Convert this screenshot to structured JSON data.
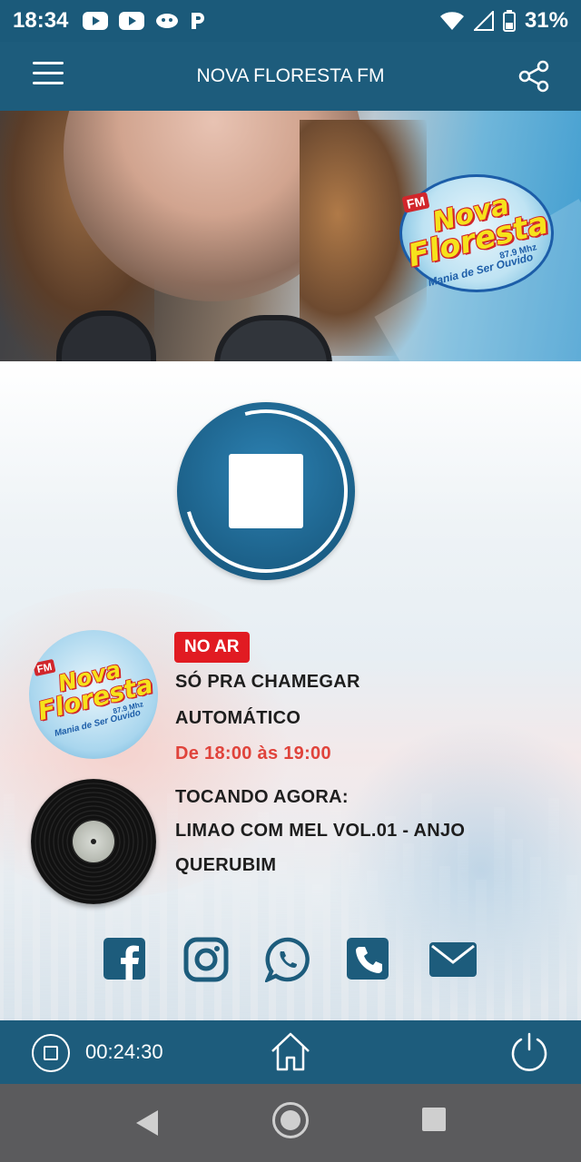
{
  "status_bar": {
    "time": "18:34",
    "battery": "31%",
    "left_icons": [
      "youtube-icon",
      "youtube-icon",
      "app-icon",
      "pandora-icon"
    ],
    "right_icons": [
      "wifi-icon",
      "signal-icon",
      "battery-icon"
    ]
  },
  "app_bar": {
    "title": "NOVA FLORESTA FM",
    "menu_icon": "menu-icon",
    "share_icon": "share-icon"
  },
  "logo": {
    "fm": "FM",
    "word1": "Nova",
    "word2": "Floresta",
    "frequency": "87.9 Mhz",
    "slogan": "Mania de Ser Ouvido"
  },
  "now_on_air": {
    "badge": "NO AR",
    "program": "SÓ PRA CHAMEGAR",
    "host": "AUTOMÁTICO",
    "schedule": "De 18:00 às 19:00"
  },
  "now_playing": {
    "label": "TOCANDO AGORA:",
    "track_line1": "LIMAO COM MEL VOL.01 - ANJO",
    "track_line2": "QUERUBIM"
  },
  "social": [
    {
      "name": "facebook-icon"
    },
    {
      "name": "instagram-icon"
    },
    {
      "name": "whatsapp-icon"
    },
    {
      "name": "phone-icon"
    },
    {
      "name": "email-icon"
    }
  ],
  "player_bar": {
    "timer": "00:24:30"
  },
  "colors": {
    "primary": "#1d5c7c",
    "accent_red": "#e11b22",
    "schedule_red": "#e0433b"
  }
}
